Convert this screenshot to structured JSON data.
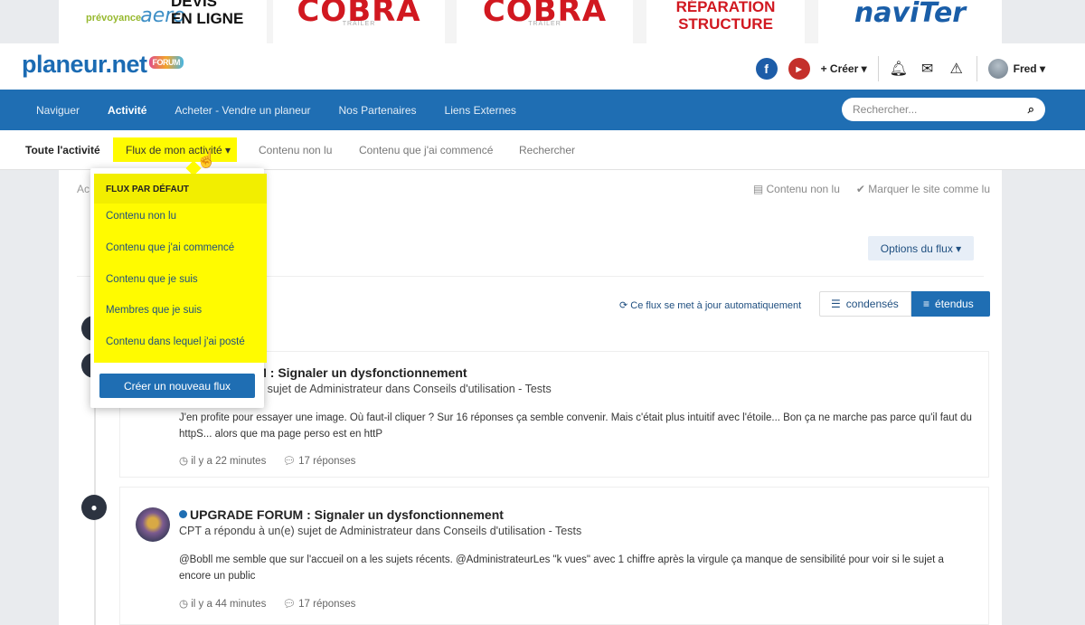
{
  "banner": {
    "ad1": {
      "logo": "aero",
      "logo_sub": "prévoyance",
      "line1": "DEVIS",
      "line2": "EN LIGNE"
    },
    "ad2": {
      "brand": "COBRA",
      "sub": "TRAILER"
    },
    "ad3": {
      "brand": "COBRA",
      "sub": "TRAILER"
    },
    "ad4": {
      "line1": "RÉPARATION",
      "line2": "STRUCTURE"
    },
    "ad5": {
      "brand": "naviTer"
    }
  },
  "header": {
    "logo": "planeur.net",
    "logo_badge": "FORUM",
    "create_label": "+ Créer ▾",
    "user_label": "Fred ▾",
    "icons": [
      "facebook-icon",
      "youtube-icon",
      "bell-icon",
      "envelope-icon",
      "warning-icon"
    ]
  },
  "nav": {
    "items": [
      {
        "label": "Naviguer"
      },
      {
        "label": "Activité",
        "active": true
      },
      {
        "label": "Acheter - Vendre un planeur"
      },
      {
        "label": "Nos Partenaires"
      },
      {
        "label": "Liens Externes"
      }
    ],
    "search_placeholder": "Rechercher..."
  },
  "subnav": {
    "items": [
      {
        "label": "Toute l'activité"
      },
      {
        "label": "Flux de mon activité ▾"
      },
      {
        "label": "Contenu non lu"
      },
      {
        "label": "Contenu que j'ai commencé"
      },
      {
        "label": "Rechercher"
      }
    ]
  },
  "main": {
    "breadcrumb": "Ac",
    "top_links": {
      "unread": "Contenu non lu",
      "mark_read": "Marquer le site comme lu"
    },
    "options_button": "Options du flux ▾",
    "auto_update": "Ce flux se met à jour automatiquement",
    "view_condensed": "condensés",
    "view_expanded": "étendus",
    "cards": [
      {
        "title": "RUM : Signaler un dysfonctionnement",
        "subtitle": "un(e) sujet de Administrateur dans Conseils d'utilisation - Tests",
        "body": "J'en profite pour essayer une image. Où faut-il cliquer ? Sur 16 réponses ça semble convenir. Mais c'était plus intuitif avec l'étoile... Bon ça ne marche pas parce qu'il faut du httpS... alors que ma page perso est en httP",
        "time": "il y a 22 minutes",
        "replies": "17 réponses"
      },
      {
        "title": "UPGRADE FORUM : Signaler un dysfonctionnement",
        "subtitle": "CPT a répondu à un(e) sujet de Administrateur dans Conseils d'utilisation - Tests",
        "body": "@Bobll me semble que sur l'accueil on a les sujets récents. @AdministrateurLes \"k vues\" avec 1 chiffre après la virgule ça manque de sensibilité pour voir si le sujet a encore un public",
        "time": "il y a 44 minutes",
        "replies": "17 réponses"
      }
    ]
  },
  "dropdown": {
    "header": "FLUX PAR DÉFAUT",
    "items": [
      {
        "label": "Contenu non lu"
      },
      {
        "label": "Contenu que j'ai commencé"
      },
      {
        "label": "Contenu que je suis"
      },
      {
        "label": "Membres que je suis"
      },
      {
        "label": "Contenu dans lequel j'ai posté"
      }
    ],
    "create_button": "Créer un nouveau flux"
  },
  "colors": {
    "nav_blue": "#1f6eb3",
    "highlight_yellow": "#fffb00",
    "ad_red": "#d11820"
  }
}
